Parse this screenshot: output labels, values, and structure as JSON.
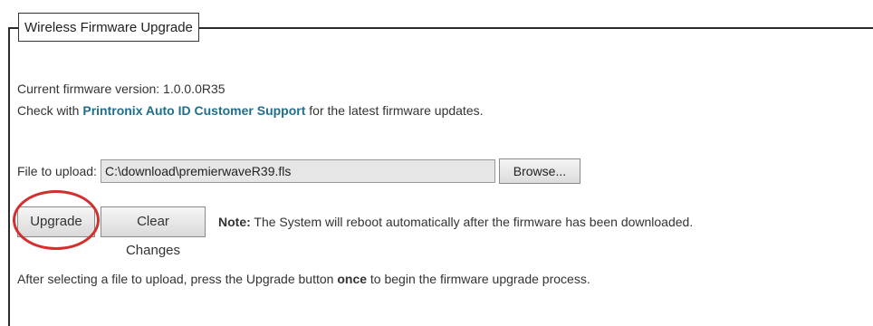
{
  "section": {
    "title": "Wireless Firmware Upgrade"
  },
  "firmware": {
    "version_text": "Current firmware version: 1.0.0.0R35",
    "check_prefix": "Check with ",
    "support_link": "Printronix Auto ID Customer Support",
    "check_suffix": " for the latest firmware updates."
  },
  "upload": {
    "label": "File to upload:",
    "file_value": "C:\\download\\premierwaveR39.fls",
    "browse_label": "Browse..."
  },
  "actions": {
    "upgrade_label": "Upgrade",
    "clear_label": "Clear Changes",
    "note_label": "Note:",
    "note_text": " The System will reboot automatically after the firmware has been downloaded."
  },
  "instructions": {
    "prefix": "After selecting a file to upload, press the Upgrade button ",
    "emphasis": "once",
    "suffix": " to begin the firmware upgrade process."
  },
  "colors": {
    "link": "#1f6f8b",
    "highlight": "#d32f2f"
  }
}
